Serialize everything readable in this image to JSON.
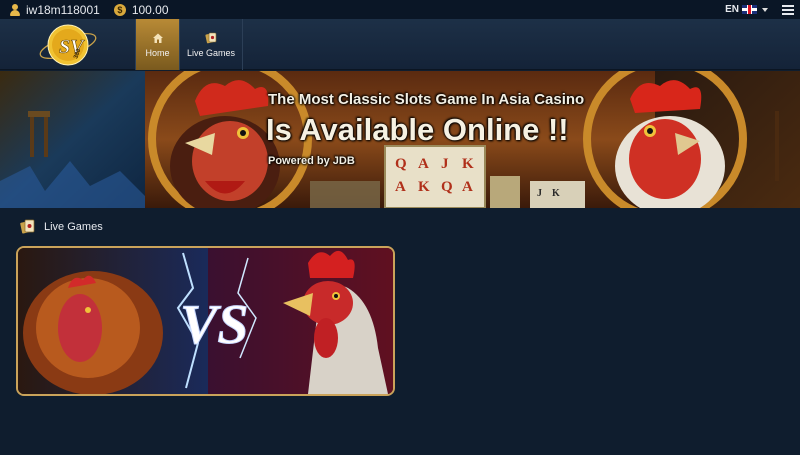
{
  "topbar": {
    "username": "iw18m118001",
    "balance": "100.00",
    "balance_icon": "$",
    "language": "EN"
  },
  "nav": {
    "logo_text": "SV",
    "logo_sub": "388",
    "tabs": [
      {
        "label": "Home",
        "icon": "home-icon",
        "active": true
      },
      {
        "label": "Live Games",
        "icon": "cards-icon",
        "active": false
      }
    ]
  },
  "banner": {
    "line1": "The Most Classic Slots Game In Asia Casino",
    "line2": "Is Available Online !!",
    "line3": "Powered by JDB",
    "tiles": [
      "Q",
      "A",
      "J",
      "K",
      "A",
      "K",
      "Q",
      "A",
      "J",
      "K"
    ]
  },
  "section": {
    "title": "Live Games",
    "icon": "cards-icon"
  },
  "game_card": {
    "versus": "VS"
  },
  "colors": {
    "background": "#0f1d2e",
    "gold": "#caa35a",
    "active_tab": "#b88a36"
  }
}
